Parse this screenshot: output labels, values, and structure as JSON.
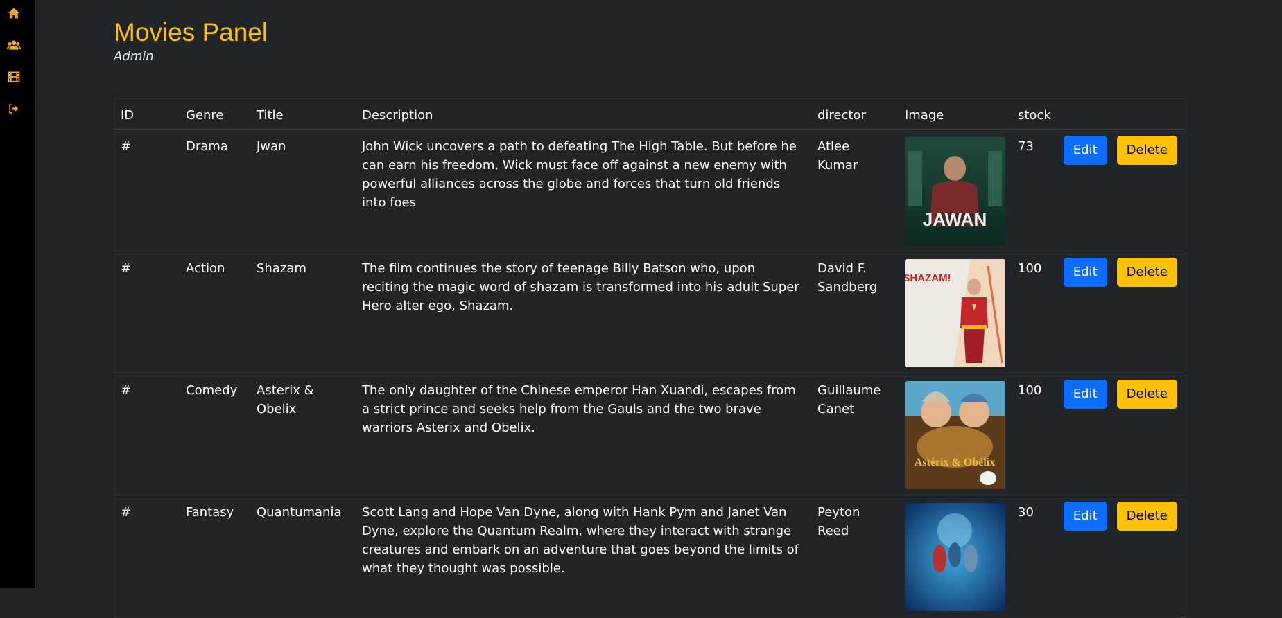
{
  "page": {
    "title": "Movies Panel",
    "subtitle": "Admin"
  },
  "sidebar": {
    "items": [
      {
        "icon": "home-icon"
      },
      {
        "icon": "users-icon"
      },
      {
        "icon": "film-icon"
      },
      {
        "icon": "logout-icon"
      }
    ]
  },
  "table": {
    "headers": {
      "id": "ID",
      "genre": "Genre",
      "title": "Title",
      "description": "Description",
      "director": "director",
      "image": "Image",
      "stock": "stock"
    },
    "edit_label": "Edit",
    "delete_label": "Delete",
    "rows": [
      {
        "id": "#",
        "genre": "Drama",
        "title": "Jwan",
        "description": "John Wick uncovers a path to defeating The High Table. But before he can earn his freedom, Wick must face off against a new enemy with powerful alliances across the globe and forces that turn old friends into foes",
        "director": "Atlee Kumar",
        "stock": "73",
        "poster_text": "JAWAN"
      },
      {
        "id": "#",
        "genre": "Action",
        "title": "Shazam",
        "description": "The film continues the story of teenage Billy Batson who, upon reciting the magic word of shazam is transformed into his adult Super Hero alter ego, Shazam.",
        "director": "David F. Sandberg",
        "stock": "100",
        "poster_text": "SHAZAM!"
      },
      {
        "id": "#",
        "genre": "Comedy",
        "title": "Asterix & Obelix",
        "description": "The only daughter of the Chinese emperor Han Xuandi, escapes from a strict prince and seeks help from the Gauls and the two brave warriors Asterix and Obelix.",
        "director": "Guillaume Canet",
        "stock": "100",
        "poster_text": "Astérix & Obélix"
      },
      {
        "id": "#",
        "genre": "Fantasy",
        "title": "Quantumania",
        "description": "Scott Lang and Hope Van Dyne, along with Hank Pym and Janet Van Dyne, explore the Quantum Realm, where they interact with strange creatures and embark on an adventure that goes beyond the limits of what they thought was possible.",
        "director": "Peyton Reed",
        "stock": "30",
        "poster_text": ""
      }
    ]
  },
  "colors": {
    "accent": "#ffc107",
    "edit_button": "#0d6efd",
    "background": "#212429",
    "sidebar": "#000000"
  }
}
